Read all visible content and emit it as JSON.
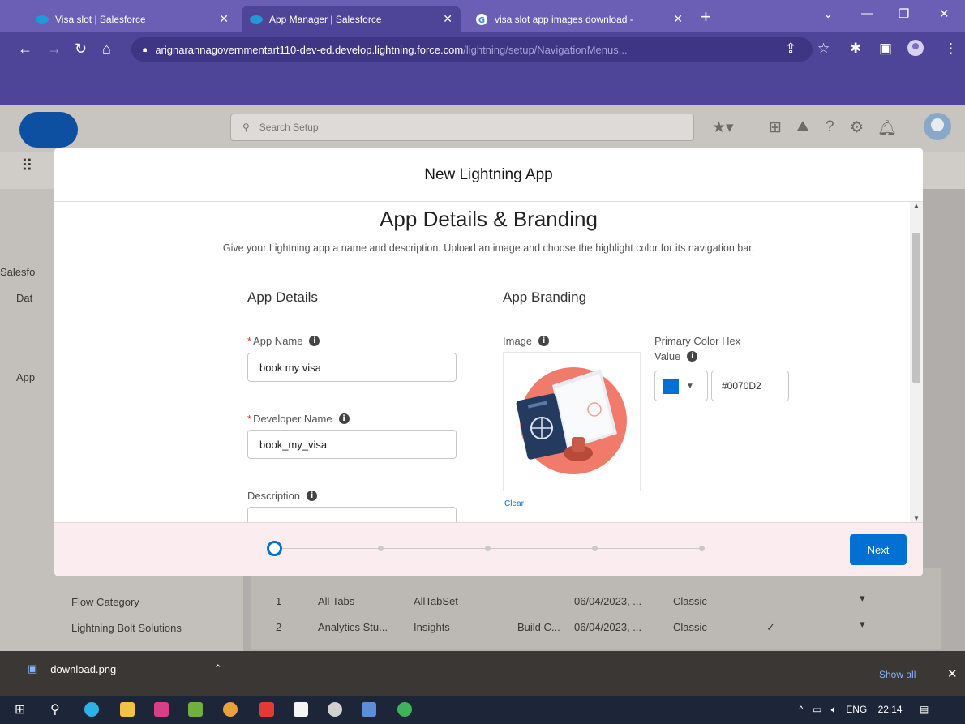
{
  "browser": {
    "tabs": [
      {
        "title": "Visa slot | Salesforce",
        "active": false
      },
      {
        "title": "App Manager | Salesforce",
        "active": true
      },
      {
        "title": "visa slot app images download -",
        "active": false
      }
    ],
    "url_host": "arignarannagovernmentart110-dev-ed.develop.lightning.force.com",
    "url_path": "/lightning/setup/NavigationMenus..."
  },
  "header": {
    "search_placeholder": "Search Setup"
  },
  "background": {
    "nav_items": [
      "Salesfo",
      "Dat",
      "App",
      "Flow Category",
      "Lightning Bolt Solutions"
    ],
    "table_rows": [
      {
        "num": "1",
        "label": "All Tabs",
        "dev": "AllTabSet",
        "desc": "",
        "date": "06/04/2023, ...",
        "type": "Classic"
      },
      {
        "num": "2",
        "label": "Analytics Stu...",
        "dev": "Insights",
        "desc": "Build C...",
        "date": "06/04/2023, ...",
        "type": "Classic"
      }
    ]
  },
  "modal": {
    "title": "New Lightning App",
    "section_title": "App Details & Branding",
    "section_desc": "Give your Lightning app a name and description. Upload an image and choose the highlight color for its navigation bar.",
    "details": {
      "heading": "App Details",
      "app_name_label": "App Name",
      "app_name_value": "book my visa",
      "dev_name_label": "Developer Name",
      "dev_name_value": "book_my_visa",
      "description_label": "Description"
    },
    "branding": {
      "heading": "App Branding",
      "image_label": "Image",
      "clear_label": "Clear",
      "color_label_1": "Primary Color Hex",
      "color_label_2": "Value",
      "color_value": "#0070D2"
    },
    "next_label": "Next"
  },
  "downloads": {
    "file": "download.png",
    "show_all": "Show all"
  },
  "taskbar": {
    "lang": "ENG",
    "time": "22:14"
  }
}
